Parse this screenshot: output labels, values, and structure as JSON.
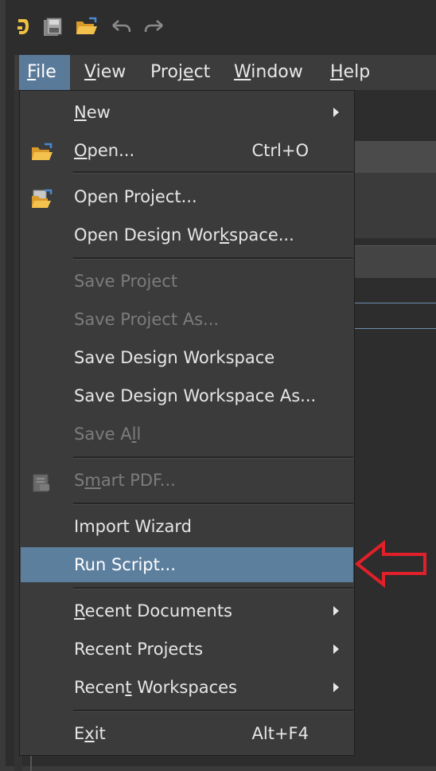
{
  "menubar": {
    "items": [
      {
        "mnemonic": "F",
        "rest": "ile"
      },
      {
        "mnemonic": "V",
        "rest": "iew"
      },
      {
        "pre": "Proj",
        "mnemonic": "e",
        "rest": "ct"
      },
      {
        "mnemonic": "W",
        "rest": "indow"
      },
      {
        "mnemonic": "H",
        "rest": "elp"
      }
    ]
  },
  "file_menu": {
    "new": {
      "pre": "",
      "mnemonic": "N",
      "rest": "ew"
    },
    "open": {
      "pre": "",
      "mnemonic": "O",
      "rest": "pen...",
      "shortcut": "Ctrl+O"
    },
    "open_project": {
      "label": "Open Project..."
    },
    "open_workspace": {
      "pre": "Open Design Wor",
      "mnemonic": "k",
      "rest": "space..."
    },
    "save_project": {
      "label": "Save Project"
    },
    "save_project_as": {
      "label": "Save Project As..."
    },
    "save_workspace": {
      "label": "Save Design Workspace"
    },
    "save_workspace_as": {
      "label": "Save Design Workspace As..."
    },
    "save_all": {
      "pre": "Save A",
      "mnemonic": "l",
      "rest": "l"
    },
    "smart_pdf": {
      "pre": "S",
      "mnemonic": "m",
      "rest": "art PDF..."
    },
    "import_wizard": {
      "label": "Import Wizard"
    },
    "run_script": {
      "label": "Run Script..."
    },
    "recent_documents": {
      "pre": "",
      "mnemonic": "R",
      "rest": "ecent Documents"
    },
    "recent_projects": {
      "label": "Recent Projects"
    },
    "recent_workspaces": {
      "pre": "Recen",
      "mnemonic": "t",
      "rest": " Workspaces"
    },
    "exit": {
      "pre": "E",
      "mnemonic": "x",
      "rest": "it",
      "shortcut": "Alt+F4"
    }
  },
  "colors": {
    "menu_bg": "#3b3b3b",
    "highlight": "#5d7f9e",
    "disabled_text": "#7c7c7c",
    "annotation": "#e0202a"
  },
  "icons": {
    "app": "altium-logo-icon",
    "save_all_toolbar": "save-all-icon",
    "open_toolbar": "folder-open-icon",
    "undo": "undo-icon",
    "redo": "redo-icon",
    "open": "folder-open-icon",
    "open_project": "open-project-icon",
    "smart_pdf": "smart-pdf-icon",
    "annotation": "arrow-left-outline-icon"
  }
}
